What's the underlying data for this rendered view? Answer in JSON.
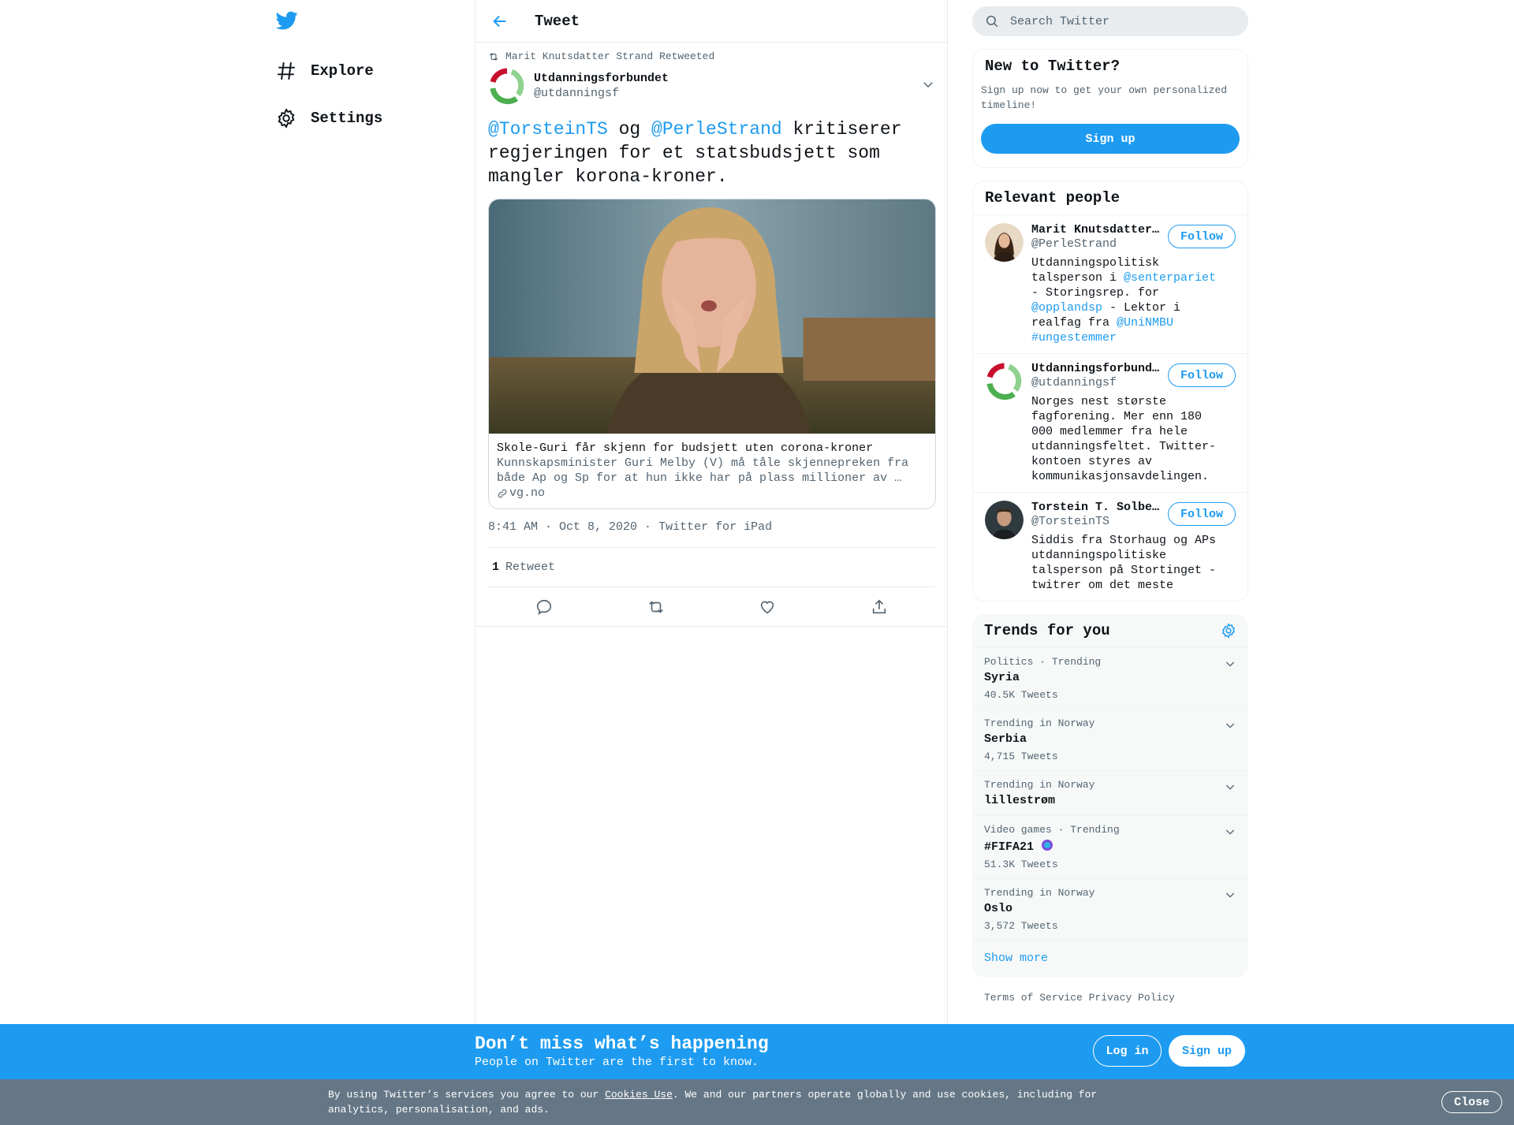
{
  "nav": {
    "explore_label": "Explore",
    "settings_label": "Settings",
    "icons": [
      "twitter-logo-icon",
      "hashtag-icon",
      "gear-icon"
    ]
  },
  "main_header": {
    "title": "Tweet",
    "back_icon": "arrow-left-icon"
  },
  "tweet": {
    "retweeted_by": "Marit Knutsdatter Strand Retweeted",
    "author_name": "Utdanningsforbundet",
    "author_handle": "@utdanningsf",
    "text_mention_1": "@TorsteinTS",
    "text_og": " og ",
    "text_mention_2": "@PerleStrand",
    "text_rest": " kritiserer regjeringen for et statsbudsjett som mangler korona-kroner.",
    "card": {
      "title": "Skole-Guri får skjenn for budsjett uten corona-kroner",
      "description": "Kunnskapsminister Guri Melby (V) må tåle skjennepreken fra både Ap og Sp for at hun ikke har på plass millioner av …",
      "domain": "vg.no"
    },
    "timestamp": "8:41 AM · Oct 8, 2020",
    "source": "Twitter for iPad",
    "retweet_count": "1",
    "retweet_label": "Retweet"
  },
  "search": {
    "placeholder": "Search Twitter"
  },
  "new_to_twitter": {
    "title": "New to Twitter?",
    "text": "Sign up now to get your own personalized timeline!",
    "button": "Sign up"
  },
  "relevant_people": {
    "title": "Relevant people",
    "follow_label": "Follow",
    "people": [
      {
        "name": "Marit Knutsdatter Strand",
        "handle": "@PerleStrand",
        "bio_1": "Utdanningspolitisk talsperson i ",
        "bio_m1": "@senterpariet",
        "bio_2": " - Storingsrep. for ",
        "bio_m2": "@opplandsp",
        "bio_3": " - Lektor i realfag fra ",
        "bio_m3": "@UniNMBU",
        "bio_4": " ",
        "bio_m4": "#ungestemmer"
      },
      {
        "name": "Utdanningsforbundet",
        "handle": "@utdanningsf",
        "bio": "Norges nest største fagforening. Mer enn 180 000 medlemmer fra hele utdanningsfeltet. Twitter-kontoen styres av kommunikasjonsavdelingen."
      },
      {
        "name": "Torstein T. Solberg",
        "handle": "@TorsteinTS",
        "bio": "Siddis fra Storhaug og APs utdanningspolitiske talsperson på Stortinget - twitrer om det meste"
      }
    ]
  },
  "trends": {
    "title": "Trends for you",
    "items": [
      {
        "context": "Politics · Trending",
        "name": "Syria",
        "count": "40.5K Tweets"
      },
      {
        "context": "Trending in Norway",
        "name": "Serbia",
        "count": "4,715 Tweets"
      },
      {
        "context": "Trending in Norway",
        "name": "lillestrøm",
        "count": ""
      },
      {
        "context": "Video games · Trending",
        "name": "#FIFA21",
        "count": "51.3K Tweets"
      },
      {
        "context": "Trending in Norway",
        "name": "Oslo",
        "count": "3,572 Tweets"
      }
    ],
    "show_more": "Show more"
  },
  "footer": {
    "terms": "Terms of Service",
    "privacy": "Privacy Policy"
  },
  "banner": {
    "title": "Don’t miss what’s happening",
    "subtitle": "People on Twitter are the first to know.",
    "login": "Log in",
    "signup": "Sign up"
  },
  "cookie": {
    "text_before": "By using Twitter’s services you agree to our ",
    "link": "Cookies Use",
    "text_after": ". We and our partners operate globally and use cookies, including for analytics, personalisation, and ads.",
    "close": "Close"
  },
  "colors": {
    "accent": "#1d9bf0",
    "text": "#0f1419",
    "muted": "#536471",
    "cookie_bg": "#657786"
  }
}
